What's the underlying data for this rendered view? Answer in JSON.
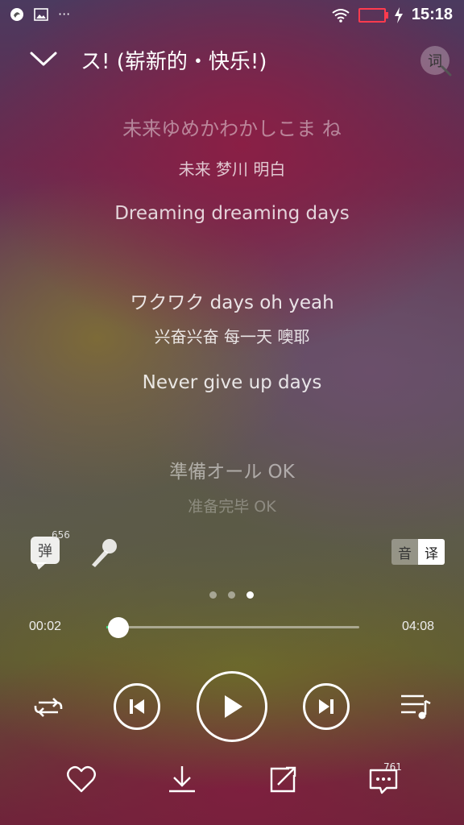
{
  "status_bar": {
    "overflow": "···",
    "time": "15:18",
    "battery_color": "#ff3b4e"
  },
  "header": {
    "title": "ス! (崭新的・快乐!)",
    "lyrics_button": "词"
  },
  "lyrics": [
    {
      "text": "未来ゆめかわかしこま ね",
      "opacity": 0.45,
      "size": 24
    },
    {
      "text": "未来 梦川 明白",
      "opacity": 0.75,
      "size": 20
    },
    {
      "text": "Dreaming dreaming days",
      "opacity": 0.8,
      "size": 23
    },
    {
      "text": "ワクワク days oh yeah",
      "opacity": 0.85,
      "size": 23
    },
    {
      "text": "兴奋兴奋 每一天 噢耶",
      "opacity": 0.85,
      "size": 20
    },
    {
      "text": "Never give up days",
      "opacity": 0.85,
      "size": 23
    },
    {
      "text": "準備オール OK",
      "opacity": 0.5,
      "size": 23
    },
    {
      "text": "准备完毕 OK",
      "opacity": 0.3,
      "size": 19
    }
  ],
  "danmaku": {
    "label": "弹",
    "count": "656"
  },
  "toggle": {
    "original": "音",
    "translation": "译"
  },
  "pager": {
    "count": 3,
    "active": 2
  },
  "progress": {
    "current": "00:02",
    "total": "04:08",
    "fraction": 0.01
  },
  "comments": {
    "count": "761"
  },
  "accent_color": "#3ed37a"
}
